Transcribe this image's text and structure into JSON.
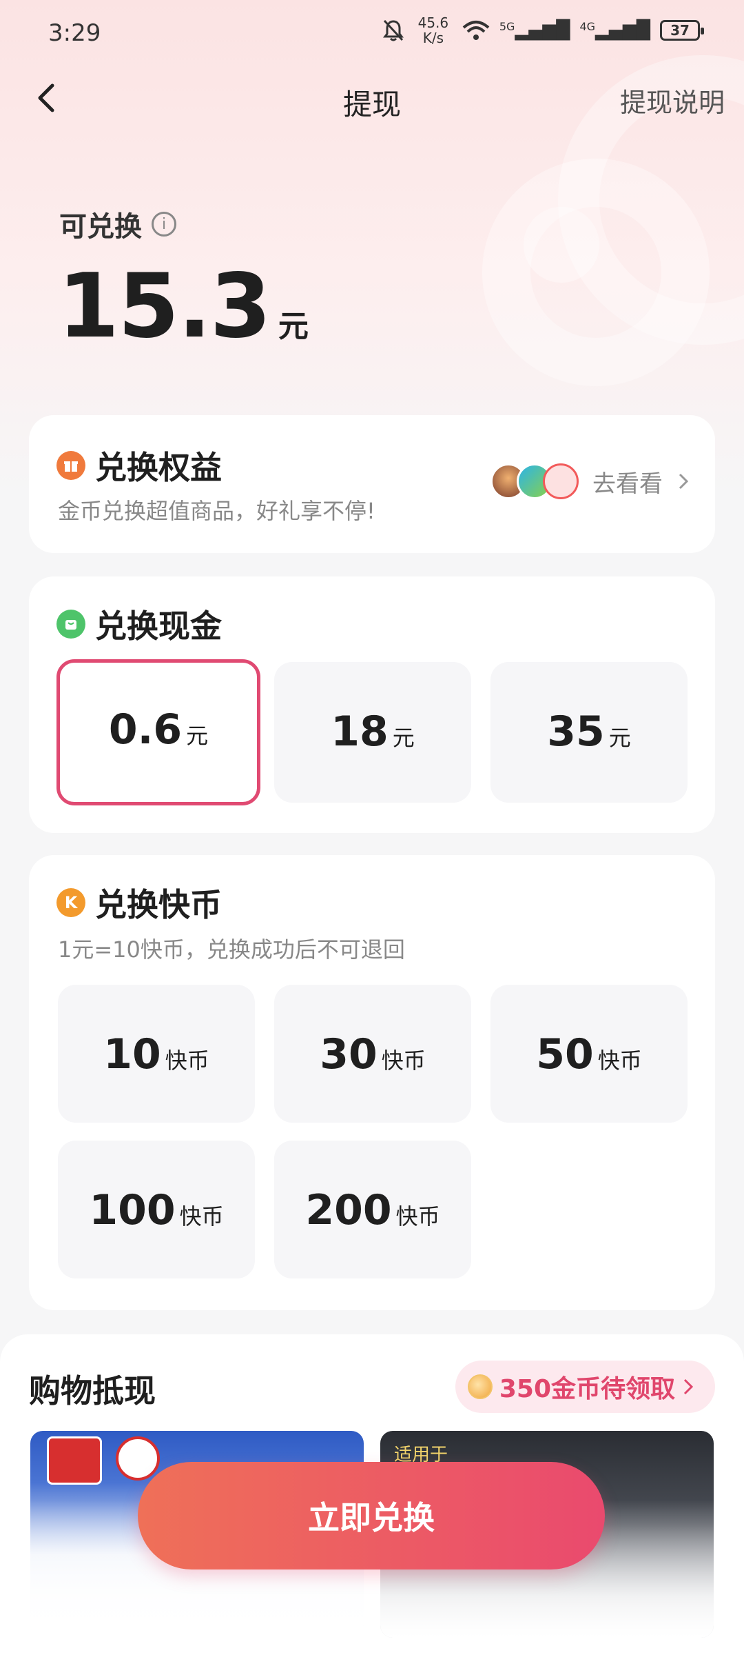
{
  "status_bar": {
    "time": "3:29",
    "speed_value": "45.6",
    "speed_unit": "K/s",
    "net1": "5G",
    "net2": "4G",
    "battery": "37"
  },
  "nav": {
    "title": "提现",
    "right_link": "提现说明"
  },
  "balance": {
    "label": "可兑换",
    "amount": "15.3",
    "unit": "元"
  },
  "rights_card": {
    "title": "兑换权益",
    "subtitle": "金币兑换超值商品，好礼享不停!",
    "link": "去看看",
    "avatar_colors": [
      "#7a3c2a",
      "#2bb4e8",
      "#f25a5a"
    ]
  },
  "cash_card": {
    "title": "兑换现金",
    "options": [
      {
        "value": "0.6",
        "unit": "元",
        "selected": true
      },
      {
        "value": "18",
        "unit": "元",
        "selected": false
      },
      {
        "value": "35",
        "unit": "元",
        "selected": false
      }
    ]
  },
  "coin_card": {
    "title": "兑换快币",
    "subtitle": "1元=10快币，兑换成功后不可退回",
    "badge_letter": "K",
    "options": [
      {
        "value": "10",
        "unit": "快币"
      },
      {
        "value": "30",
        "unit": "快币"
      },
      {
        "value": "50",
        "unit": "快币"
      },
      {
        "value": "100",
        "unit": "快币"
      },
      {
        "value": "200",
        "unit": "快币"
      }
    ]
  },
  "shopping": {
    "title": "购物抵现",
    "coins_pending": "350金币待领取",
    "product2_tag": "适用于"
  },
  "cta": {
    "label": "立即兑换"
  },
  "colors": {
    "accent": "#e04a72",
    "cta_start": "#ef7058",
    "cta_end": "#ea4a6e",
    "gift_icon": "#f07a3c",
    "cash_icon": "#4ec46a",
    "coin_icon": "#f39a2c"
  }
}
